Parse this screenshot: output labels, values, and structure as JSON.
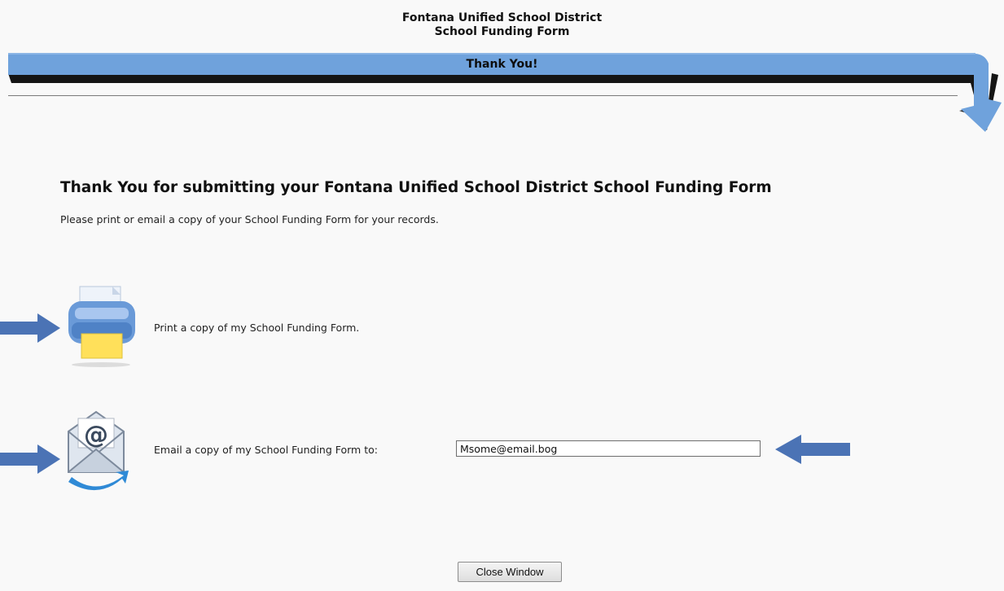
{
  "header": {
    "district": "Fontana Unified School District",
    "form_name": "School Funding Form"
  },
  "banner": {
    "title": "Thank You!"
  },
  "main": {
    "heading": "Thank You for submitting your Fontana Unified School District School Funding Form",
    "instruction": "Please print or email a copy of your School Funding Form for your records."
  },
  "print_option": {
    "label": "Print a copy of my School Funding Form.",
    "icon": "printer-icon"
  },
  "email_option": {
    "label": "Email a copy of my School Funding Form to:",
    "value": "Msome@email.bog",
    "icon": "email-at-icon"
  },
  "footer": {
    "close_label": "Close Window"
  },
  "colors": {
    "banner_blue": "#6fa2dc",
    "banner_shadow": "#1a1a1a",
    "arrow_blue": "#4b73b5"
  }
}
